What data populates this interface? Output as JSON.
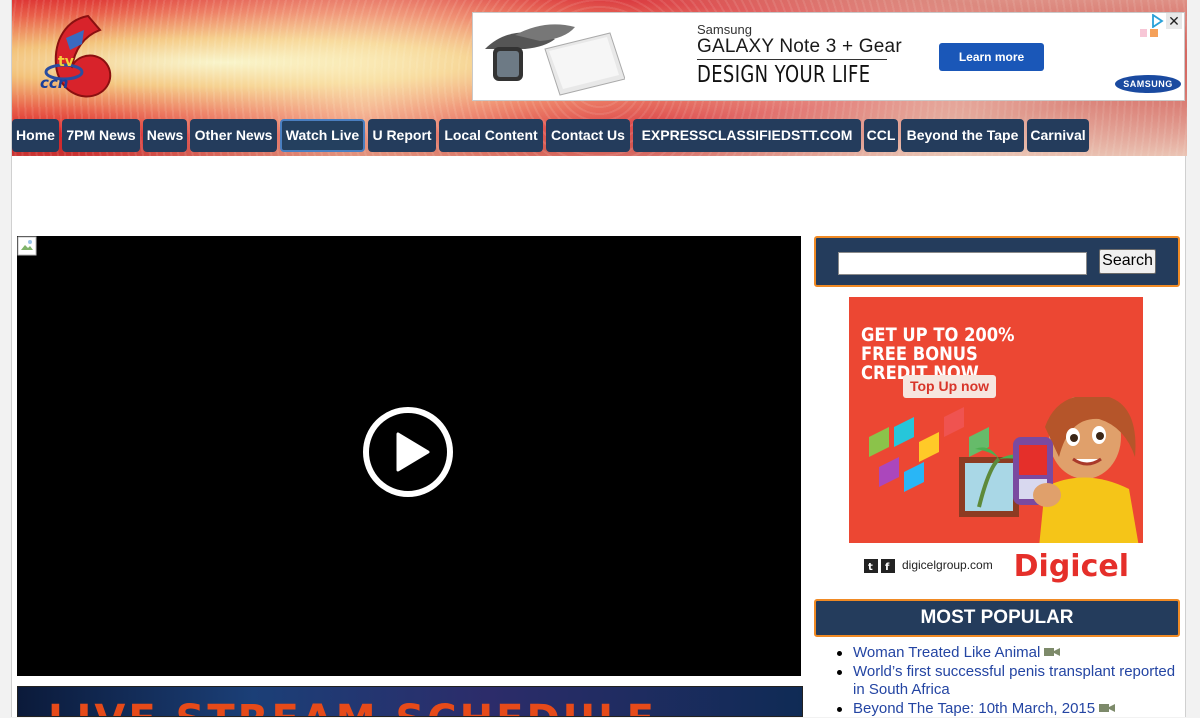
{
  "header": {
    "logo_alt": "CCN TV6"
  },
  "ad_banner": {
    "brand": "Samsung",
    "model": "GALAXY Note 3 + Gear",
    "tagline": "DESIGN YOUR LIFE",
    "cta": "Learn more",
    "logo": "SAMSUNG",
    "choices_icon": "adchoices-icon",
    "close": "✕"
  },
  "nav": {
    "items": [
      {
        "label": "Home"
      },
      {
        "label": "7PM News"
      },
      {
        "label": "News"
      },
      {
        "label": "Other News"
      },
      {
        "label": "Watch Live",
        "active": true
      },
      {
        "label": "U Report"
      },
      {
        "label": "Local Content"
      },
      {
        "label": "Contact Us"
      },
      {
        "label": "EXPRESSCLASSIFIEDSTT.COM"
      },
      {
        "label": "CCL"
      },
      {
        "label": "Beyond the Tape"
      },
      {
        "label": "Carnival"
      }
    ]
  },
  "video": {
    "play_icon": "play-icon",
    "broken_image_icon": "broken-image-icon"
  },
  "schedule_banner": {
    "text": "LIVE STREAM SCHEDULE"
  },
  "search": {
    "value": "",
    "button_label": "Search"
  },
  "digicel_ad": {
    "headline": "GET UP TO 200% FREE BONUS CREDIT NOW",
    "cta": "Top Up now",
    "url": "digicelgroup.com",
    "brand": "Digicel"
  },
  "most_popular": {
    "title": "MOST POPULAR",
    "items": [
      {
        "title": "Woman Treated Like Animal",
        "has_video": true
      },
      {
        "title": "World’s first successful penis transplant reported in South Africa",
        "has_video": false
      },
      {
        "title": "Beyond The Tape: 10th March, 2015",
        "has_video": true
      }
    ]
  },
  "colors": {
    "nav_bg": "#243c5c",
    "accent_orange": "#f08a24",
    "link_blue": "#2445a3",
    "digicel_red": "#ec4733"
  }
}
